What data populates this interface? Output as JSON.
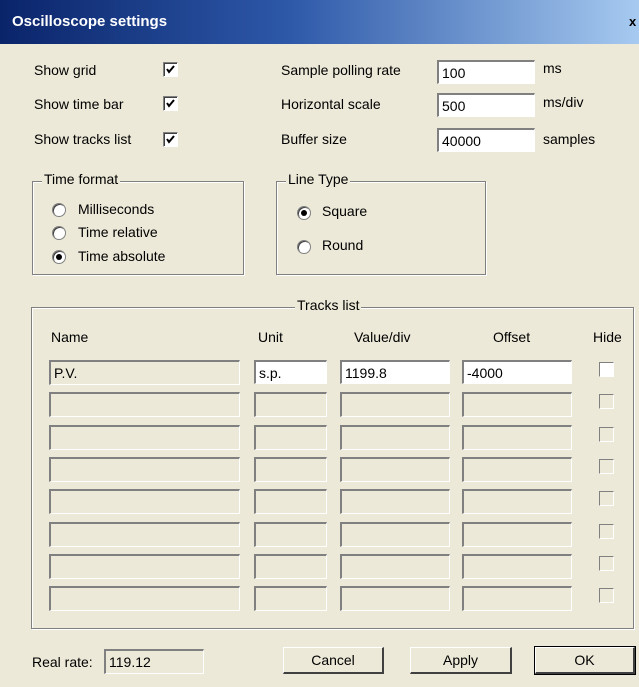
{
  "window": {
    "title": "Oscilloscope settings",
    "close_glyph": "x"
  },
  "display": {
    "show_grid": {
      "label": "Show grid",
      "checked": true
    },
    "show_time_bar": {
      "label": "Show time bar",
      "checked": true
    },
    "show_tracks_list": {
      "label": "Show tracks list",
      "checked": true
    }
  },
  "params": {
    "sample_polling_rate": {
      "label": "Sample polling rate",
      "value": "100",
      "unit": "ms"
    },
    "horizontal_scale": {
      "label": "Horizontal scale",
      "value": "500",
      "unit": "ms/div"
    },
    "buffer_size": {
      "label": "Buffer size",
      "value": "40000",
      "unit": "samples"
    }
  },
  "time_format": {
    "title": "Time format",
    "options": [
      "Milliseconds",
      "Time relative",
      "Time absolute"
    ],
    "selected": 2
  },
  "line_type": {
    "title": "Line Type",
    "options": [
      "Square",
      "Round"
    ],
    "selected": 0
  },
  "tracks": {
    "title": "Tracks list",
    "headers": {
      "name": "Name",
      "unit": "Unit",
      "value_div": "Value/div",
      "offset": "Offset",
      "hide": "Hide"
    },
    "rows": [
      {
        "name": "P.V.",
        "unit": "s.p.",
        "value_div": "1199.8",
        "offset": "-4000",
        "hide": false,
        "enabled": true
      },
      {
        "name": "",
        "unit": "",
        "value_div": "",
        "offset": "",
        "hide": false,
        "enabled": false
      },
      {
        "name": "",
        "unit": "",
        "value_div": "",
        "offset": "",
        "hide": false,
        "enabled": false
      },
      {
        "name": "",
        "unit": "",
        "value_div": "",
        "offset": "",
        "hide": false,
        "enabled": false
      },
      {
        "name": "",
        "unit": "",
        "value_div": "",
        "offset": "",
        "hide": false,
        "enabled": false
      },
      {
        "name": "",
        "unit": "",
        "value_div": "",
        "offset": "",
        "hide": false,
        "enabled": false
      },
      {
        "name": "",
        "unit": "",
        "value_div": "",
        "offset": "",
        "hide": false,
        "enabled": false
      },
      {
        "name": "",
        "unit": "",
        "value_div": "",
        "offset": "",
        "hide": false,
        "enabled": false
      }
    ]
  },
  "footer": {
    "real_rate_label": "Real rate:",
    "real_rate_value": "119.12",
    "cancel_label": "Cancel",
    "apply_label": "Apply",
    "ok_label": "OK"
  }
}
